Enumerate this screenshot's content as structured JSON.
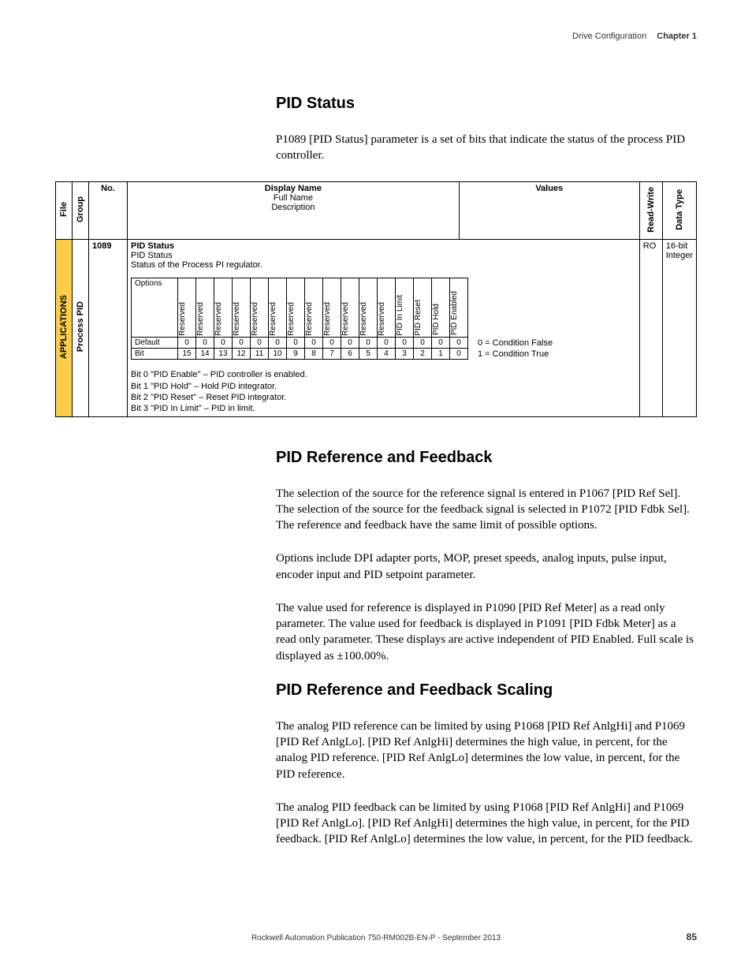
{
  "header": {
    "doc_section": "Drive Configuration",
    "chapter": "Chapter 1"
  },
  "sections": {
    "pid_status": {
      "title": "PID Status",
      "intro": "P1089 [PID Status] parameter is a set of bits that indicate the status of the process PID controller."
    },
    "pid_ref_fb": {
      "title": "PID Reference and Feedback",
      "p1": "The selection of the source for the reference signal is entered in P1067 [PID Ref Sel]. The selection of the source for the feedback signal is selected in P1072 [PID Fdbk Sel]. The reference and feedback have the same limit of possible options.",
      "p2": "Options include DPI adapter ports, MOP, preset speeds, analog inputs, pulse input, encoder input and PID setpoint parameter.",
      "p3": "The value used for reference is displayed in P1090 [PID Ref Meter] as a read only parameter. The value used for feedback is displayed in P1091 [PID Fdbk Meter] as a read only parameter. These displays are active independent of PID Enabled. Full scale is displayed as ±100.00%."
    },
    "pid_scaling": {
      "title": "PID Reference and Feedback Scaling",
      "p1": "The analog PID reference can be limited by using P1068 [PID Ref AnlgHi] and P1069 [PID Ref AnlgLo]. [PID Ref AnlgHi] determines the high value, in percent, for the analog PID reference. [PID Ref AnlgLo] determines the low value, in percent, for the PID reference.",
      "p2": "The analog PID feedback can be limited by using P1068 [PID Ref AnlgHi] and P1069 [PID Ref AnlgLo]. [PID Ref AnlgHi] determines the high value, in percent, for the PID feedback. [PID Ref AnlgLo] determines the low value, in percent, for the PID feedback."
    }
  },
  "table": {
    "columns": {
      "file": "File",
      "group": "Group",
      "no": "No.",
      "display": "Display Name",
      "fullname": "Full Name",
      "description": "Description",
      "values": "Values",
      "rw": "Read-Write",
      "datatype": "Data Type"
    },
    "row": {
      "file_val": "APPLICATIONS",
      "group_val": "Process PID",
      "no_val": "1089",
      "display_name": "PID Status",
      "full_name": "PID Status",
      "desc_text": "Status of the Process PI regulator.",
      "values_val": "",
      "rw_val": "RO",
      "datatype_val": "16-bit Integer",
      "bits": {
        "row_labels": {
          "options": "Options",
          "default": "Default",
          "bit": "Bit"
        },
        "cells": [
          {
            "opt": "Reserved",
            "def": "0",
            "bit": "15"
          },
          {
            "opt": "Reserved",
            "def": "0",
            "bit": "14"
          },
          {
            "opt": "Reserved",
            "def": "0",
            "bit": "13"
          },
          {
            "opt": "Reserved",
            "def": "0",
            "bit": "12"
          },
          {
            "opt": "Reserved",
            "def": "0",
            "bit": "11"
          },
          {
            "opt": "Reserved",
            "def": "0",
            "bit": "10"
          },
          {
            "opt": "Reserved",
            "def": "0",
            "bit": "9"
          },
          {
            "opt": "Reserved",
            "def": "0",
            "bit": "8"
          },
          {
            "opt": "Reserved",
            "def": "0",
            "bit": "7"
          },
          {
            "opt": "Reserved",
            "def": "0",
            "bit": "6"
          },
          {
            "opt": "Reserved",
            "def": "0",
            "bit": "5"
          },
          {
            "opt": "Reserved",
            "def": "0",
            "bit": "4"
          },
          {
            "opt": "PID In Limit",
            "def": "0",
            "bit": "3"
          },
          {
            "opt": "PID Reset",
            "def": "0",
            "bit": "2"
          },
          {
            "opt": "PID Hold",
            "def": "0",
            "bit": "1"
          },
          {
            "opt": "PID Enabled",
            "def": "0",
            "bit": "0"
          }
        ],
        "legend0": "0 = Condition False",
        "legend1": "1 = Condition True",
        "descriptions": [
          "Bit 0 \"PID Enable\" – PID controller is enabled.",
          "Bit 1 \"PID Hold\" – Hold PID integrator.",
          "Bit 2 \"PID Reset\" – Reset PID integrator.",
          "Bit 3 \"PID In Limit\" – PID in limit."
        ]
      }
    }
  },
  "footer": {
    "publication": "Rockwell Automation Publication 750-RM002B-EN-P - September 2013",
    "page": "85"
  }
}
